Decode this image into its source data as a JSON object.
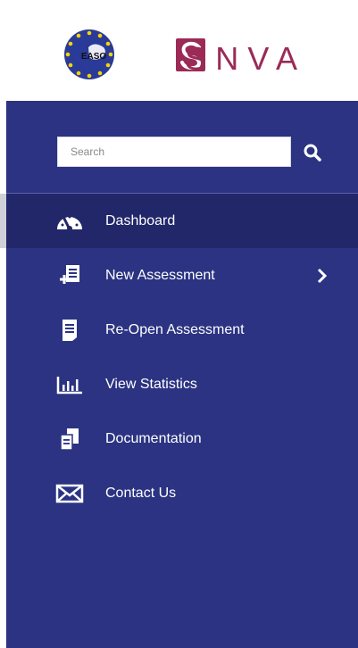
{
  "header": {
    "easo_logo_text": "EASO",
    "snva_logo_text": "SNVA"
  },
  "search": {
    "placeholder": "Search"
  },
  "menu": [
    {
      "label": "Dashboard",
      "icon": "dashboard-gauge-icon",
      "active": true
    },
    {
      "label": "New Assessment",
      "icon": "new-assessment-icon",
      "has_submenu": true
    },
    {
      "label": "Re-Open Assessment",
      "icon": "document-icon"
    },
    {
      "label": "View Statistics",
      "icon": "bar-chart-icon"
    },
    {
      "label": "Documentation",
      "icon": "documents-icon"
    },
    {
      "label": "Contact Us",
      "icon": "envelope-icon"
    }
  ],
  "colors": {
    "sidebar_bg": "#2b3382",
    "active_bg": "#212769",
    "snva_brand": "#9b2a57"
  }
}
